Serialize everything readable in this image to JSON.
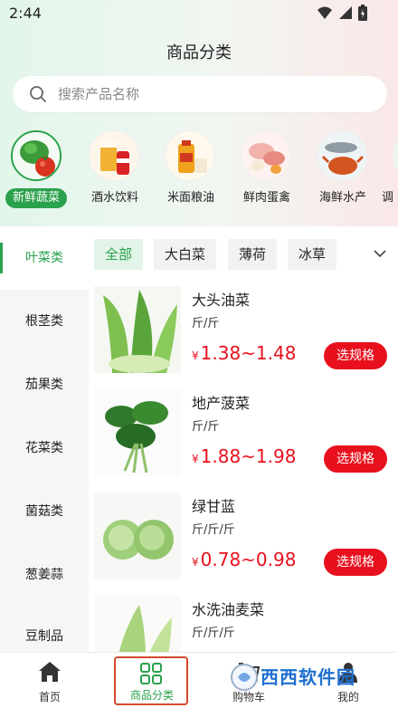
{
  "status": {
    "time": "2:44"
  },
  "header": {
    "title": "商品分类"
  },
  "search": {
    "placeholder": "搜索产品名称"
  },
  "categories": [
    {
      "label": "新鲜蔬菜",
      "active": true
    },
    {
      "label": "酒水饮料",
      "active": false
    },
    {
      "label": "米面粮油",
      "active": false
    },
    {
      "label": "鲜肉蛋禽",
      "active": false
    },
    {
      "label": "海鲜水产",
      "active": false
    },
    {
      "label": "调",
      "active": false
    }
  ],
  "sidebar": {
    "items": [
      {
        "label": "叶菜类",
        "active": true
      },
      {
        "label": "根茎类",
        "active": false
      },
      {
        "label": "茄果类",
        "active": false
      },
      {
        "label": "花菜类",
        "active": false
      },
      {
        "label": "菌菇类",
        "active": false
      },
      {
        "label": "葱姜蒜",
        "active": false
      },
      {
        "label": "豆制品",
        "active": false
      }
    ]
  },
  "subcategories": [
    {
      "label": "全部",
      "active": true
    },
    {
      "label": "大白菜",
      "active": false
    },
    {
      "label": "薄荷",
      "active": false
    },
    {
      "label": "冰草",
      "active": false
    }
  ],
  "currency": "¥",
  "products": [
    {
      "name": "大头油菜",
      "unit": "斤/斤",
      "price": "1.38~1.48",
      "button": "选规格"
    },
    {
      "name": "地产菠菜",
      "unit": "斤/斤",
      "price": "1.88~1.98",
      "button": "选规格"
    },
    {
      "name": "绿甘蓝",
      "unit": "斤/斤/斤",
      "price": "0.78~0.98",
      "button": "选规格"
    },
    {
      "name": "水洗油麦菜",
      "unit": "斤/斤/斤",
      "price": "",
      "button": ""
    }
  ],
  "tabbar": {
    "items": [
      {
        "label": "首页"
      },
      {
        "label": "商品分类"
      },
      {
        "label": "购物车"
      },
      {
        "label": "我的"
      }
    ]
  },
  "watermark": {
    "text": "西西软件园"
  },
  "colors": {
    "accent": "#2aa14d",
    "price": "#e8101d",
    "sidebar_bg": "#f6f6f6"
  }
}
